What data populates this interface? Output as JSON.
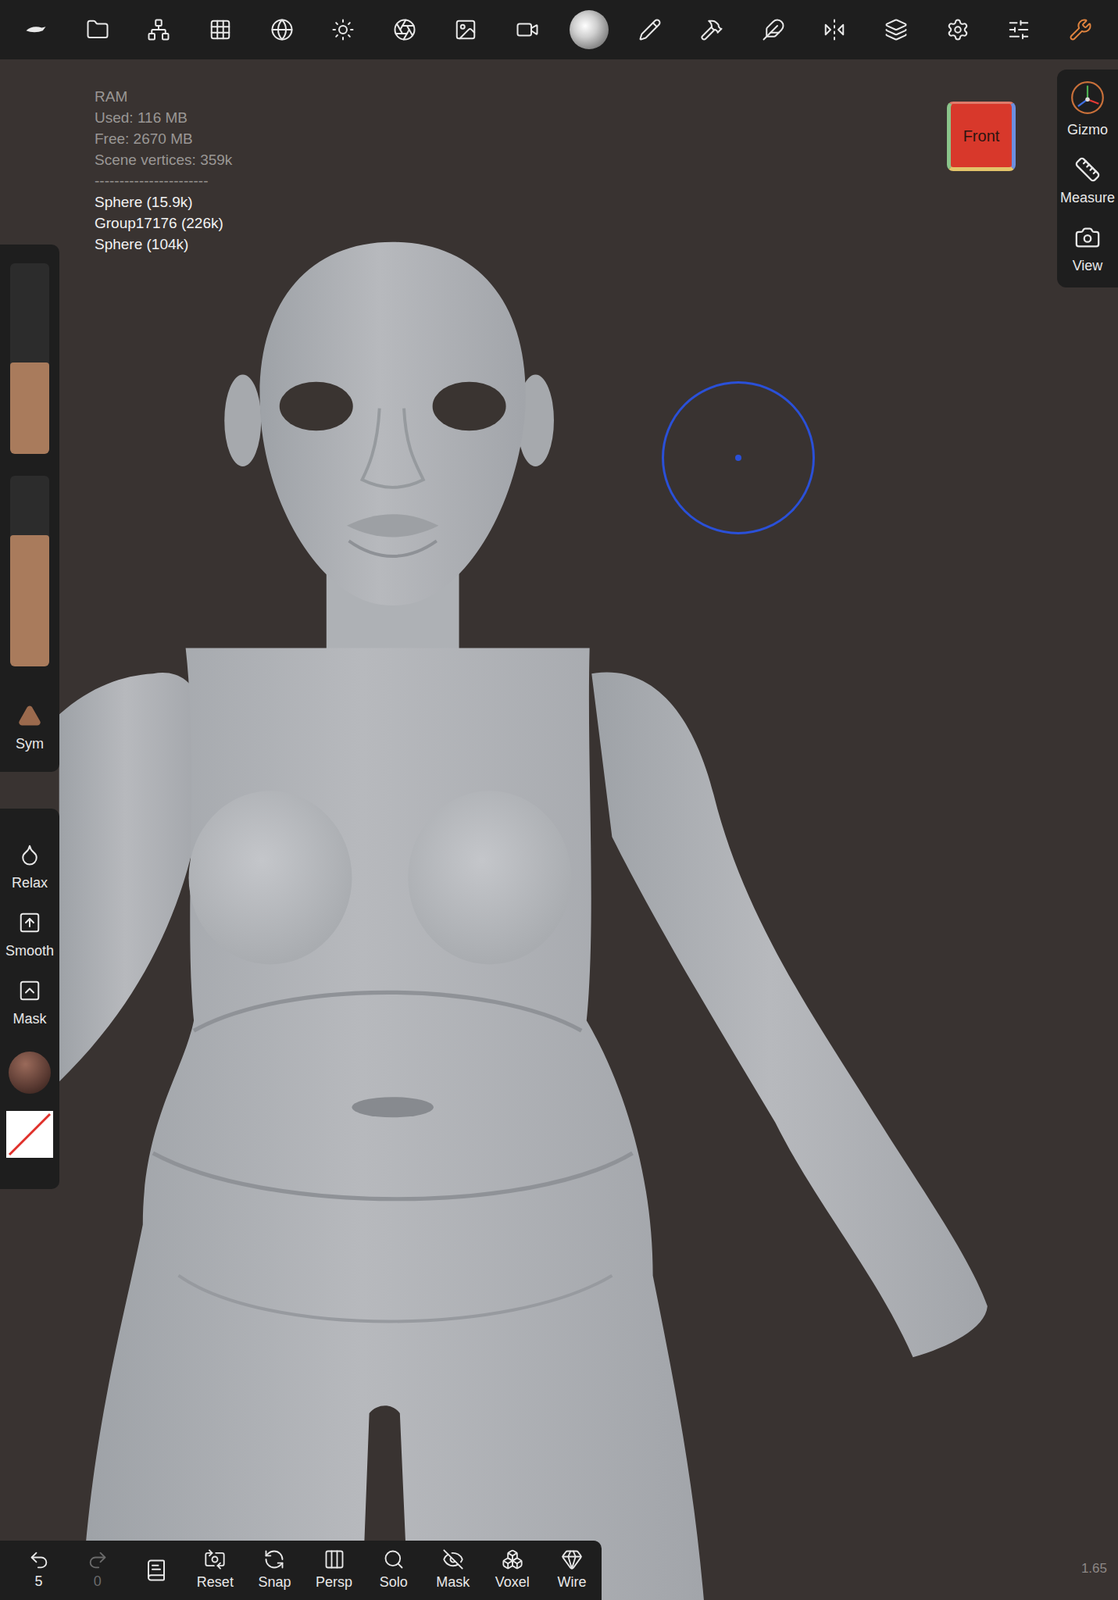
{
  "toolbar": [
    {
      "selected": false
    },
    {
      "selected": false
    },
    {
      "selected": false
    },
    {
      "selected": false
    },
    {
      "selected": false
    },
    {
      "selected": false
    },
    {
      "selected": false
    },
    {
      "selected": false
    },
    {
      "selected": false
    },
    {
      "selected": false
    },
    {
      "selected": false
    },
    {
      "selected": false
    },
    {
      "selected": false
    },
    {
      "selected": false
    },
    {
      "selected": false
    },
    {
      "selected": false
    },
    {
      "selected": false
    },
    {
      "selected": true
    }
  ],
  "stats": {
    "title": "RAM",
    "lines": [
      "Used: 116 MB",
      "Free: 2670 MB",
      "Scene vertices: 359k"
    ],
    "separator": "-----------------------",
    "objects": [
      "Sphere (15.9k)",
      "Group17176 (226k)",
      "Sphere (104k)"
    ]
  },
  "view_cube": {
    "label": "Front"
  },
  "right_panel": [
    "Gizmo",
    "Measure",
    "View"
  ],
  "left_sliders": [
    {
      "level": 0.48
    },
    {
      "level": 0.69
    }
  ],
  "symmetry": {
    "label": "Sym"
  },
  "left_tools": [
    "Relax",
    "Smooth",
    "Mask"
  ],
  "history": {
    "undo": "5",
    "redo": "0",
    "redo_disabled": true
  },
  "bottom_bar": [
    "Reset",
    "Snap",
    "Persp",
    "Solo",
    "Mask",
    "Voxel",
    "Wire"
  ],
  "zoom": "1.65"
}
